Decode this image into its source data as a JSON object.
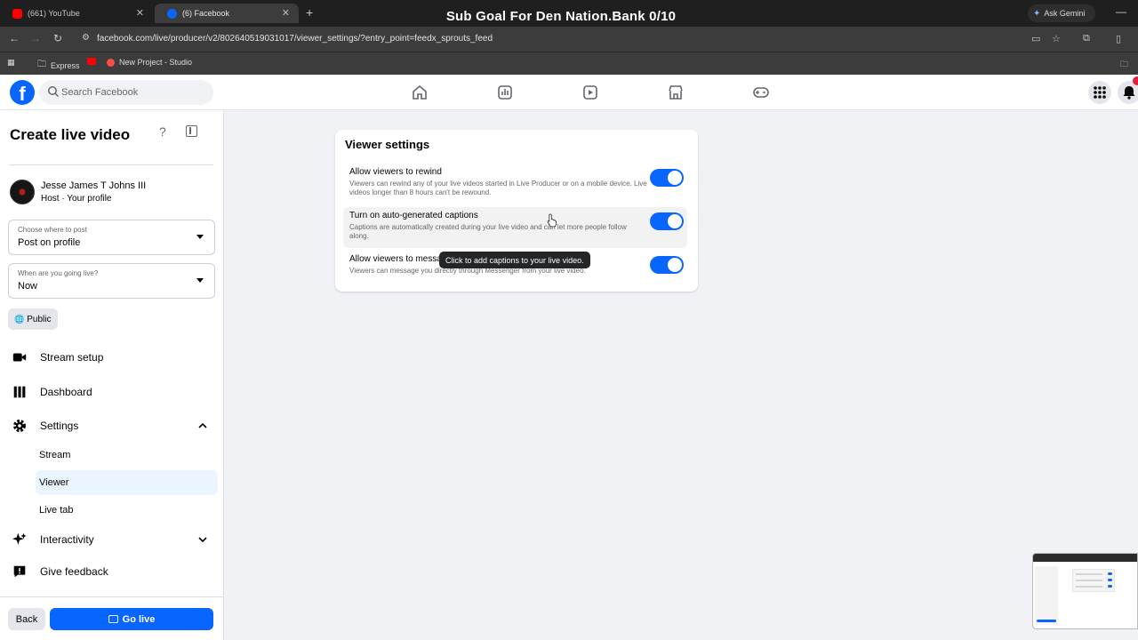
{
  "browser": {
    "tabs": [
      {
        "label": "(661) YouTube",
        "icon": "youtube-icon",
        "active": false
      },
      {
        "label": "(6) Facebook",
        "icon": "facebook-icon",
        "active": true
      }
    ],
    "overlay_title": "Sub Goal For Den Nation.Bank 0/10",
    "ask_gemini": "Ask Gemini",
    "url": "facebook.com/live/producer/v2/802640519031017/viewer_settings/?entry_point=feedx_sprouts_feed",
    "bookmarks": [
      {
        "label": "Express",
        "icon": "folder-icon"
      },
      {
        "label": "",
        "icon": "youtube-icon"
      },
      {
        "label": "New Project - Studio",
        "icon": "studio-icon"
      }
    ]
  },
  "header": {
    "logo": "f",
    "search_placeholder": "Search Facebook"
  },
  "sidebar": {
    "title": "Create live video",
    "host_name": "Jesse James T Johns III",
    "host_sub": "Host · Your profile",
    "post_where": {
      "label": "Choose where to post",
      "value": "Post on profile"
    },
    "going_live": {
      "label": "When are you going live?",
      "value": "Now"
    },
    "privacy": "Public",
    "menu": {
      "stream_setup": "Stream setup",
      "dashboard": "Dashboard",
      "settings": "Settings",
      "sub_stream": "Stream",
      "sub_viewer": "Viewer",
      "sub_live_tab": "Live tab",
      "interactivity": "Interactivity",
      "give_feedback": "Give feedback"
    },
    "back": "Back",
    "go_live": "Go live"
  },
  "viewer_settings": {
    "title": "Viewer settings",
    "items": [
      {
        "title": "Allow viewers to rewind",
        "description": "Viewers can rewind any of your live videos started in Live Producer or on a mobile device. Live videos longer than 8 hours can't be rewound.",
        "enabled": true
      },
      {
        "title": "Turn on auto-generated captions",
        "description": "Captions are automatically created during your live video and can let more people follow along.",
        "enabled": true
      },
      {
        "title": "Allow viewers to message you",
        "description": "Viewers can message you directly through Messenger from your live video.",
        "enabled": true
      }
    ],
    "tooltip": "Click to add captions to your live video."
  },
  "colors": {
    "brand": "#0866ff",
    "page_bg": "#f0f2f5",
    "chrome_bg": "#3c3c3c"
  }
}
